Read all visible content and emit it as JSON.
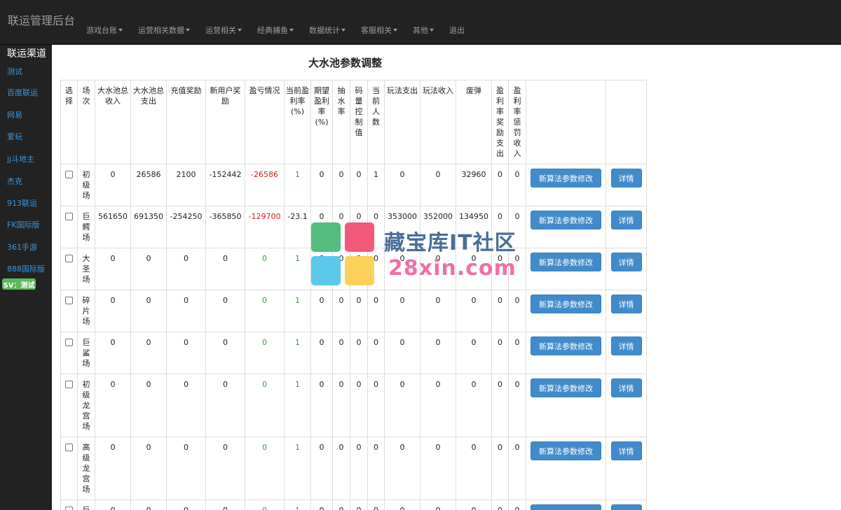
{
  "app": {
    "title": "联运管理后台"
  },
  "nav": [
    {
      "label": "游戏台账",
      "dropdown": true
    },
    {
      "label": "运营相关数据",
      "dropdown": true
    },
    {
      "label": "运营相关",
      "dropdown": true
    },
    {
      "label": "经典捕鱼",
      "dropdown": true
    },
    {
      "label": "数据统计",
      "dropdown": true
    },
    {
      "label": "客服相关",
      "dropdown": true
    },
    {
      "label": "其他",
      "dropdown": true
    },
    {
      "label": "退出",
      "dropdown": false
    }
  ],
  "sidebar": {
    "title": "联运渠道",
    "items": [
      "测试",
      "百度联运",
      "网易",
      "爱玩",
      "jj斗地主",
      "杰克",
      "913联运",
      "FK国际版",
      "361手游",
      "888国际版"
    ],
    "badge": "SV：测试"
  },
  "main": {
    "title": "大水池参数调整",
    "columns": [
      "选择",
      "场次",
      "大水池总收入",
      "大水池总支出",
      "充值奖励",
      "新用户奖励",
      "盈亏情况",
      "当前盈利率(%)",
      "期望盈利率(%)",
      "抽水率",
      "码量控制值",
      "当前人数",
      "玩法支出",
      "玩法收入",
      "废弹",
      "盈利率奖励支出",
      "盈利率惩罚收入",
      "",
      ""
    ],
    "button_algo": "新算法参数修改",
    "button_detail": "详情",
    "rows": [
      {
        "name": "初级场",
        "cells": [
          "0",
          "26586",
          "2100",
          "-152442",
          "-26586",
          "1",
          "0",
          "0",
          "0",
          "1",
          "0",
          "0",
          "32960",
          "0",
          "0"
        ]
      },
      {
        "name": "巨鳄场",
        "cells": [
          "561650",
          "691350",
          "-254250",
          "-365850",
          "-129700",
          "-23.1",
          "0",
          "0",
          "0",
          "0",
          "353000",
          "352000",
          "134950",
          "0",
          "0"
        ]
      },
      {
        "name": "大圣场",
        "cells": [
          "0",
          "0",
          "0",
          "0",
          "0",
          "1",
          "0",
          "0",
          "0",
          "0",
          "0",
          "0",
          "0",
          "0",
          "0"
        ]
      },
      {
        "name": "碎片场",
        "cells": [
          "0",
          "0",
          "0",
          "0",
          "0",
          "1",
          "0",
          "0",
          "0",
          "0",
          "0",
          "0",
          "0",
          "0",
          "0"
        ]
      },
      {
        "name": "巨鲨场",
        "cells": [
          "0",
          "0",
          "0",
          "0",
          "0",
          "1",
          "0",
          "0",
          "0",
          "0",
          "0",
          "0",
          "0",
          "0",
          "0"
        ]
      },
      {
        "name": "初级龙宫场",
        "cells": [
          "0",
          "0",
          "0",
          "0",
          "0",
          "1",
          "0",
          "0",
          "0",
          "0",
          "0",
          "0",
          "0",
          "0",
          "0"
        ]
      },
      {
        "name": "高级龙宫场",
        "cells": [
          "0",
          "0",
          "0",
          "0",
          "0",
          "1",
          "0",
          "0",
          "0",
          "0",
          "0",
          "0",
          "0",
          "0",
          "0"
        ]
      },
      {
        "name": "巨",
        "cells": [
          "0",
          "0",
          "0",
          "0",
          "0",
          "1",
          "0",
          "0",
          "0",
          "0",
          "0",
          "0",
          "0",
          "0",
          "0"
        ]
      }
    ]
  },
  "watermark": {
    "line1": "藏宝库IT社区",
    "line2": "28xin.com"
  },
  "colors": {
    "topbar": "#222222",
    "link": "#3a96dd",
    "negative": "#cc2222",
    "positive": "#3c9a3c",
    "button": "#428bca",
    "badge": "#5cb85c"
  }
}
